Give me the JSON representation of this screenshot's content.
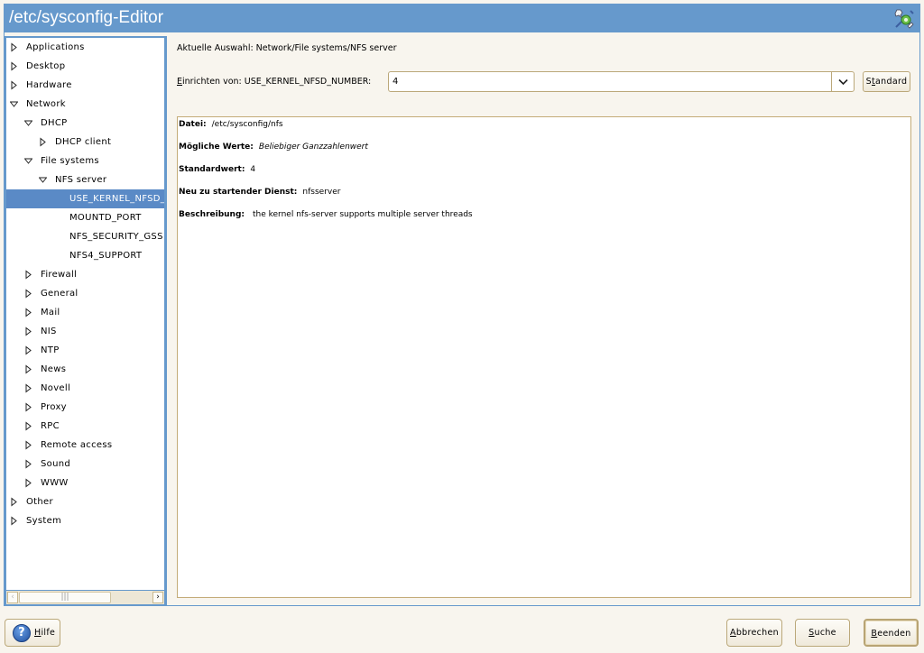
{
  "window": {
    "title": "/etc/sysconfig-Editor",
    "app_icon": "wrench-tool-icon"
  },
  "tree": {
    "items": [
      {
        "label": "Applications",
        "level": 0,
        "state": "collapsed"
      },
      {
        "label": "Desktop",
        "level": 0,
        "state": "collapsed"
      },
      {
        "label": "Hardware",
        "level": 0,
        "state": "collapsed"
      },
      {
        "label": "Network",
        "level": 0,
        "state": "expanded"
      },
      {
        "label": "DHCP",
        "level": 1,
        "state": "expanded"
      },
      {
        "label": "DHCP client",
        "level": 2,
        "state": "collapsed"
      },
      {
        "label": "File systems",
        "level": 1,
        "state": "expanded"
      },
      {
        "label": "NFS server",
        "level": 2,
        "state": "expanded"
      },
      {
        "label": "USE_KERNEL_NFSD_",
        "level": 3,
        "state": "leaf",
        "selected": true
      },
      {
        "label": "MOUNTD_PORT",
        "level": 3,
        "state": "leaf"
      },
      {
        "label": "NFS_SECURITY_GSS",
        "level": 3,
        "state": "leaf"
      },
      {
        "label": "NFS4_SUPPORT",
        "level": 3,
        "state": "leaf"
      },
      {
        "label": "Firewall",
        "level": 1,
        "state": "collapsed"
      },
      {
        "label": "General",
        "level": 1,
        "state": "collapsed"
      },
      {
        "label": "Mail",
        "level": 1,
        "state": "collapsed"
      },
      {
        "label": "NIS",
        "level": 1,
        "state": "collapsed"
      },
      {
        "label": "NTP",
        "level": 1,
        "state": "collapsed"
      },
      {
        "label": "News",
        "level": 1,
        "state": "collapsed"
      },
      {
        "label": "Novell",
        "level": 1,
        "state": "collapsed"
      },
      {
        "label": "Proxy",
        "level": 1,
        "state": "collapsed"
      },
      {
        "label": "RPC",
        "level": 1,
        "state": "collapsed"
      },
      {
        "label": "Remote access",
        "level": 1,
        "state": "collapsed"
      },
      {
        "label": "Sound",
        "level": 1,
        "state": "collapsed"
      },
      {
        "label": "WWW",
        "level": 1,
        "state": "collapsed"
      },
      {
        "label": "Other",
        "level": 0,
        "state": "collapsed"
      },
      {
        "label": "System",
        "level": 0,
        "state": "collapsed"
      }
    ],
    "scrollbar": {
      "left_arrow": "‹",
      "right_arrow": "›",
      "grip": "|||"
    }
  },
  "main": {
    "current_selection": "Aktuelle Auswahl: Network/File systems/NFS server",
    "setup_label_first": "E",
    "setup_label_rest": "inrichten von: USE_KERNEL_NFSD_NUMBER:",
    "value": "4",
    "dropdown_icon": "chevron-down-icon",
    "standard_button": {
      "pre": "S",
      "ul": "t",
      "post": "andard"
    },
    "info": {
      "file_label": "Datei:",
      "file_value": "/etc/sysconfig/nfs",
      "possible_label": "Mögliche Werte:",
      "possible_value": "Beliebiger Ganzzahlenwert",
      "default_label": "Standardwert:",
      "default_value": "4",
      "service_label": "Neu zu startender Dienst:",
      "service_value": "nfsserver",
      "description_label": "Beschreibung:",
      "description_value": "the kernel nfs-server supports multiple server threads"
    }
  },
  "footer": {
    "help": {
      "ul": "H",
      "rest": "ilfe"
    },
    "cancel": {
      "ul": "A",
      "rest": "bbrechen"
    },
    "search": {
      "ul": "S",
      "rest": "uche"
    },
    "finish": {
      "ul": "B",
      "rest": "eenden"
    }
  }
}
